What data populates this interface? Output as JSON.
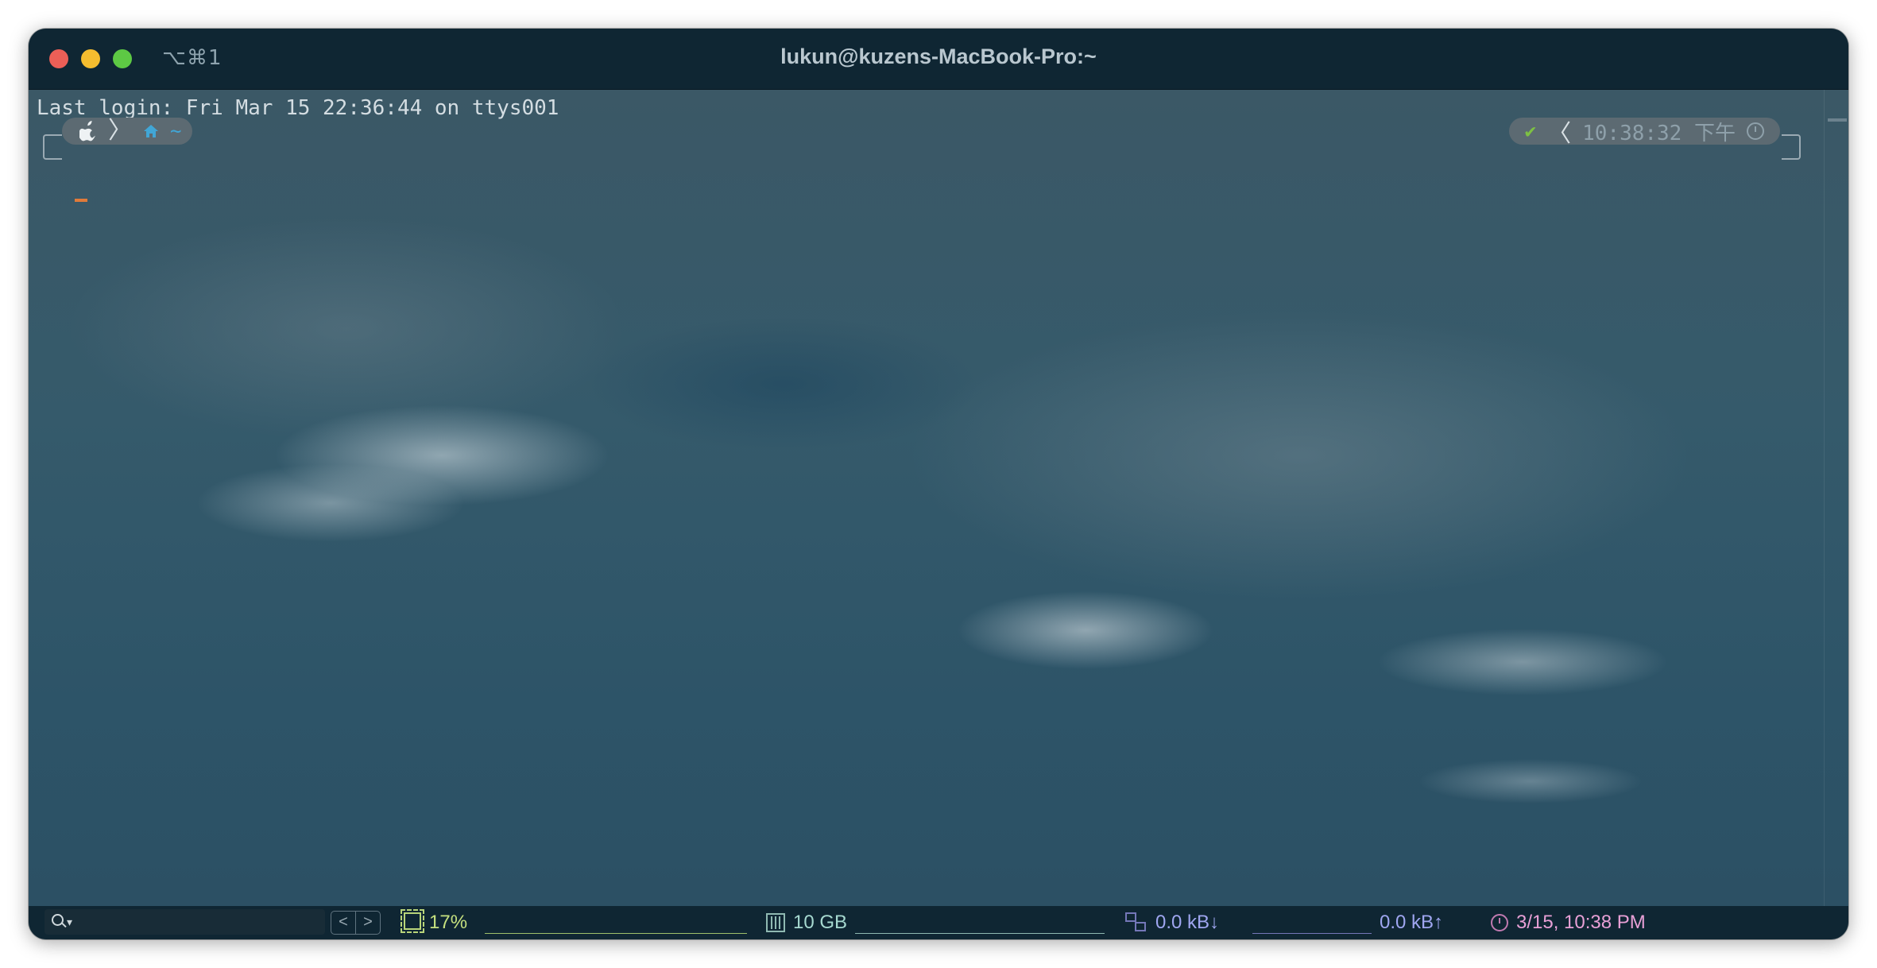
{
  "titlebar": {
    "shortcut": "⌥⌘1",
    "title": "lukun@kuzens-MacBook-Pro:~"
  },
  "terminal": {
    "last_login": "Last login: Fri Mar 15 22:36:44 on ttys001",
    "prompt_left": {
      "os_icon": "apple-icon",
      "home_icon": "home-icon",
      "path": "~"
    },
    "prompt_right": {
      "status_icon": "check-icon",
      "time": "10:38:32 下午",
      "clock_icon": "clock-icon"
    }
  },
  "statusbar": {
    "search_placeholder": "",
    "nav_prev": "<",
    "nav_next": ">",
    "cpu": "17%",
    "memory": "10 GB",
    "net_down": "0.0 kB↓",
    "net_up": "0.0 kB↑",
    "datetime": "3/15, 10:38 PM"
  },
  "colors": {
    "titlebar_bg": "#0f2633",
    "cpu": "#c5e07f",
    "memory": "#a6d9d0",
    "network": "#9fa6f0",
    "datetime": "#e8a0d6",
    "cursor": "#e07a3a"
  }
}
